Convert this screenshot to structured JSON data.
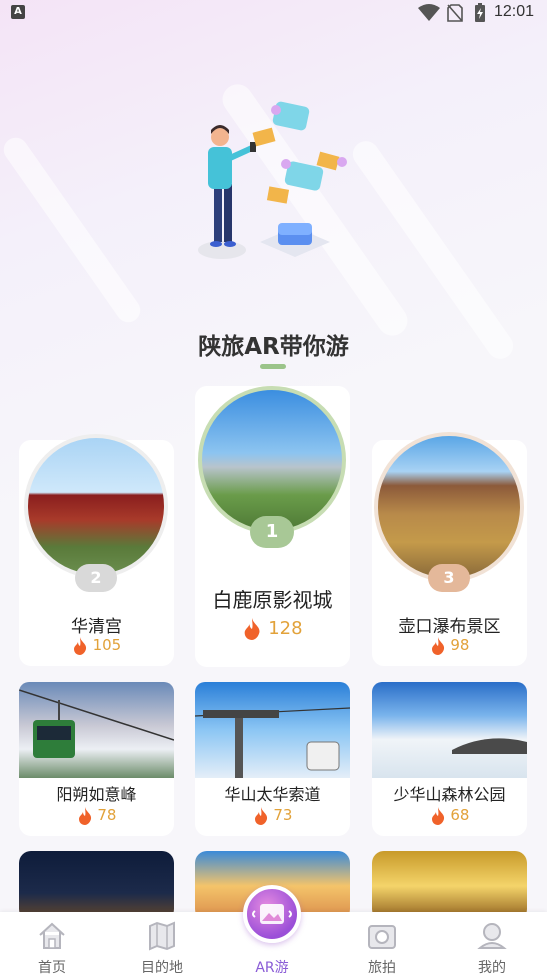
{
  "status_bar": {
    "time": "12:01",
    "app_badge": "A"
  },
  "section": {
    "title": "陕旅AR带你游"
  },
  "top3": [
    {
      "rank": "1",
      "name": "白鹿原影视城",
      "hot": "128"
    },
    {
      "rank": "2",
      "name": "华清宫",
      "hot": "105"
    },
    {
      "rank": "3",
      "name": "壶口瀑布景区",
      "hot": "98"
    }
  ],
  "grid": [
    {
      "name": "阳朔如意峰",
      "hot": "78"
    },
    {
      "name": "华山太华索道",
      "hot": "73"
    },
    {
      "name": "少华山森林公园",
      "hot": "68"
    }
  ],
  "bottom_nav": [
    {
      "label": "首页",
      "icon": "home-icon"
    },
    {
      "label": "目的地",
      "icon": "map-icon"
    },
    {
      "label": "AR游",
      "icon": "ar-icon"
    },
    {
      "label": "旅拍",
      "icon": "camera-icon"
    },
    {
      "label": "我的",
      "icon": "profile-icon"
    }
  ],
  "colors": {
    "accent": "#9bc48a",
    "hot": "#e2a23a",
    "flame": "#f0622a",
    "ar_active": "#8a5cd6"
  }
}
